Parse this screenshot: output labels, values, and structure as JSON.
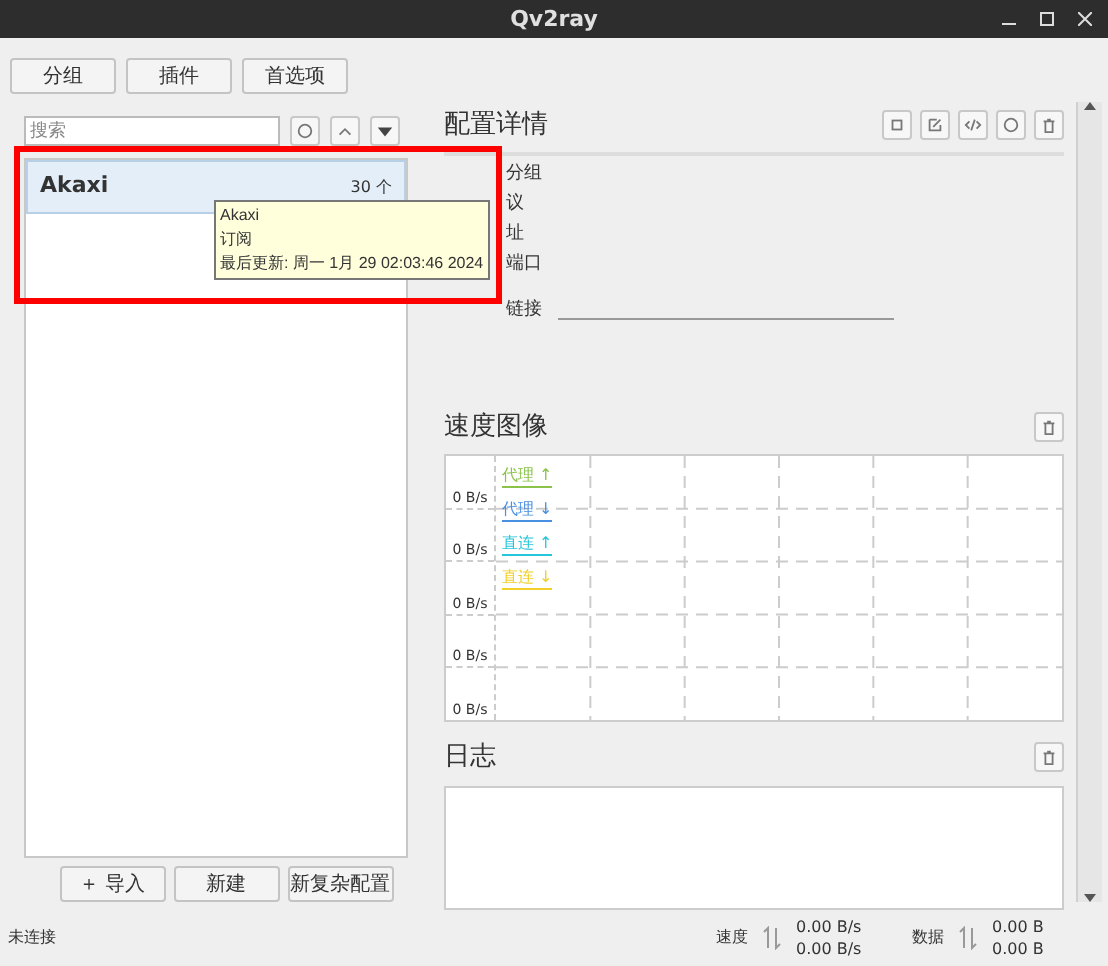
{
  "window": {
    "title": "Qv2ray"
  },
  "toolbar": [
    "分组",
    "插件",
    "首选项"
  ],
  "search": {
    "placeholder": "搜索"
  },
  "groups": [
    {
      "name": "Akaxi",
      "count": "30 个",
      "selected": true
    }
  ],
  "tooltip": {
    "lines": [
      "Akaxi",
      "订阅",
      "最后更新: 周一 1月 29 02:03:46 2024"
    ]
  },
  "list_buttons": [
    "＋ 导入",
    "新建",
    "新复杂配置"
  ],
  "details": {
    "title": "配置详情",
    "fields": [
      {
        "label": "分组"
      },
      {
        "label": "议"
      },
      {
        "label": "址"
      },
      {
        "label": "端口"
      },
      {
        "label": "链接",
        "kind": "line"
      }
    ]
  },
  "speed_chart": {
    "title": "速度图像",
    "y_labels": [
      "0 B/s",
      "0 B/s",
      "0 B/s",
      "0 B/s",
      "0 B/s"
    ],
    "legend": [
      {
        "label": "代理 ↑",
        "color": "#8bc34a"
      },
      {
        "label": "代理 ↓",
        "color": "#4a90e2"
      },
      {
        "label": "直连 ↑",
        "color": "#26c6da"
      },
      {
        "label": "直连 ↓",
        "color": "#f2d027"
      }
    ]
  },
  "log": {
    "title": "日志"
  },
  "status_bar": {
    "connection": "未连接",
    "speed_label": "速度",
    "speed_up": "0.00 B/s",
    "speed_down": "0.00 B/s",
    "data_label": "数据",
    "data_up": "0.00 B",
    "data_down": "0.00 B"
  }
}
